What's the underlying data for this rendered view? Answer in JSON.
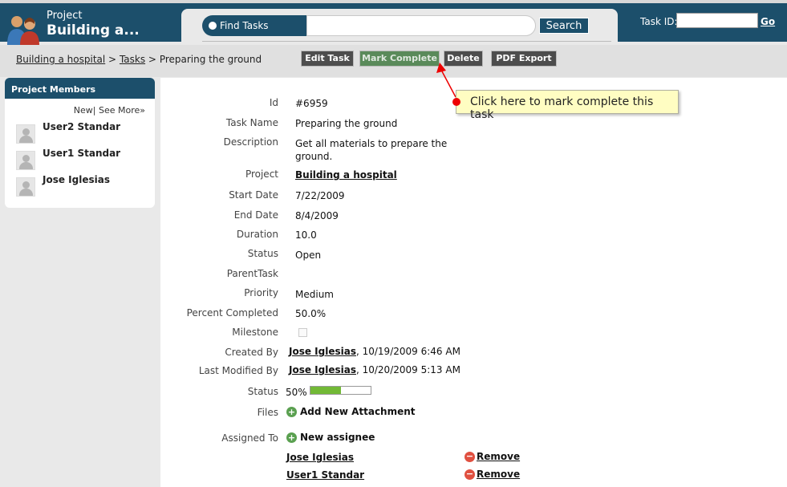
{
  "header": {
    "project_label": "Project",
    "project_name": "Building a...",
    "find_tab": "Find Tasks",
    "search_button": "Search",
    "task_id_label": "Task ID:",
    "go_link": "Go"
  },
  "breadcrumb": {
    "items": [
      "Building a hospital",
      "Tasks"
    ],
    "separator": ">",
    "current": "Preparing the ground"
  },
  "toolbar": {
    "edit": "Edit Task",
    "mark_complete": "Mark Complete",
    "delete": "Delete",
    "pdf": "PDF Export"
  },
  "callout": {
    "text": "Click here to mark complete this task"
  },
  "sidebar": {
    "title": "Project Members",
    "new_link": "New",
    "divider": "|",
    "see_more": "See More»",
    "members": [
      "User2 Standar",
      "User1 Standar",
      "Jose Iglesias"
    ]
  },
  "task": {
    "labels": {
      "id": "Id",
      "name": "Task Name",
      "description": "Description",
      "project": "Project",
      "start": "Start Date",
      "end": "End Date",
      "duration": "Duration",
      "status": "Status",
      "parent": "ParentTask",
      "priority": "Priority",
      "percent": "Percent Completed",
      "milestone": "Milestone",
      "created": "Created By",
      "modified": "Last Modified By",
      "status2": "Status",
      "files": "Files",
      "assigned": "Assigned To"
    },
    "id": "#6959",
    "name": "Preparing the ground",
    "description": "Get all materials to prepare the ground.",
    "project": "Building a hospital",
    "start": "7/22/2009",
    "end": "8/4/2009",
    "duration": "10.0",
    "status": "Open",
    "priority": "Medium",
    "percent": "50.0%",
    "milestone": false,
    "created_by": "Jose Iglesias",
    "created_at": ", 10/19/2009 6:46 AM",
    "modified_by": "Jose Iglesias",
    "modified_at": ", 10/20/2009 5:13 AM",
    "progress_text": "50%",
    "progress_fraction": 0.5,
    "add_attachment": "Add New Attachment",
    "new_assignee": "New assignee",
    "assignees": [
      "Jose Iglesias",
      "User1 Standar"
    ],
    "remove_label": "Remove"
  },
  "colors": {
    "header_bg": "#1c4f6b",
    "progress_fill": "#72b936",
    "callout_bg": "#fffdc2"
  }
}
